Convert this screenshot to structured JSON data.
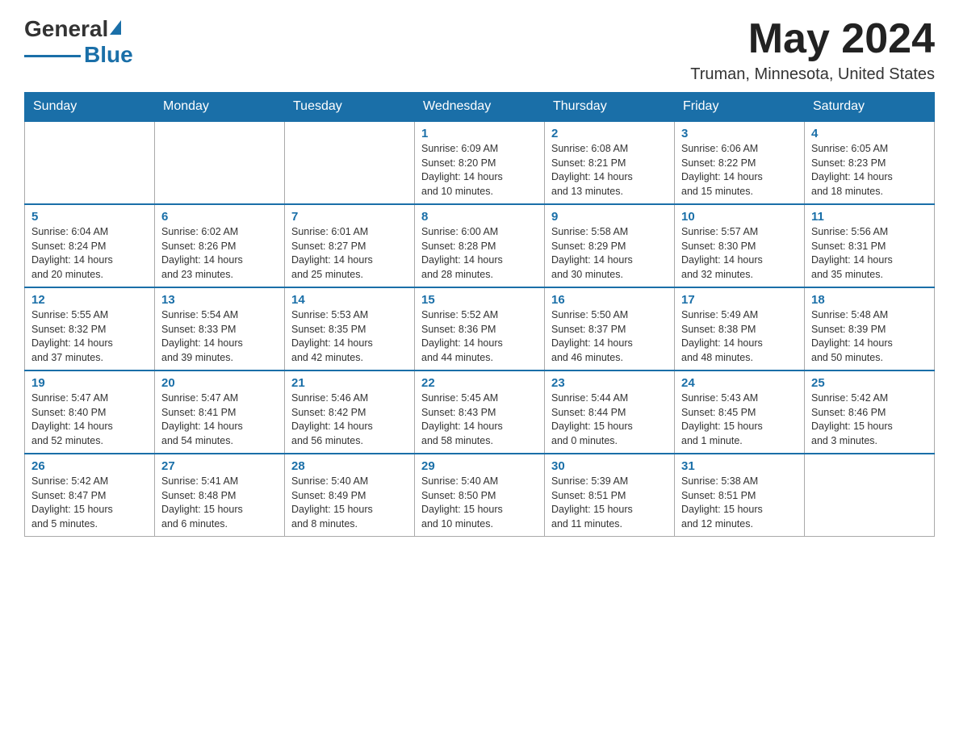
{
  "header": {
    "logo": {
      "general": "General",
      "blue": "Blue"
    },
    "month_title": "May 2024",
    "location": "Truman, Minnesota, United States"
  },
  "days_of_week": [
    "Sunday",
    "Monday",
    "Tuesday",
    "Wednesday",
    "Thursday",
    "Friday",
    "Saturday"
  ],
  "weeks": [
    [
      {
        "day": "",
        "info": ""
      },
      {
        "day": "",
        "info": ""
      },
      {
        "day": "",
        "info": ""
      },
      {
        "day": "1",
        "info": "Sunrise: 6:09 AM\nSunset: 8:20 PM\nDaylight: 14 hours\nand 10 minutes."
      },
      {
        "day": "2",
        "info": "Sunrise: 6:08 AM\nSunset: 8:21 PM\nDaylight: 14 hours\nand 13 minutes."
      },
      {
        "day": "3",
        "info": "Sunrise: 6:06 AM\nSunset: 8:22 PM\nDaylight: 14 hours\nand 15 minutes."
      },
      {
        "day": "4",
        "info": "Sunrise: 6:05 AM\nSunset: 8:23 PM\nDaylight: 14 hours\nand 18 minutes."
      }
    ],
    [
      {
        "day": "5",
        "info": "Sunrise: 6:04 AM\nSunset: 8:24 PM\nDaylight: 14 hours\nand 20 minutes."
      },
      {
        "day": "6",
        "info": "Sunrise: 6:02 AM\nSunset: 8:26 PM\nDaylight: 14 hours\nand 23 minutes."
      },
      {
        "day": "7",
        "info": "Sunrise: 6:01 AM\nSunset: 8:27 PM\nDaylight: 14 hours\nand 25 minutes."
      },
      {
        "day": "8",
        "info": "Sunrise: 6:00 AM\nSunset: 8:28 PM\nDaylight: 14 hours\nand 28 minutes."
      },
      {
        "day": "9",
        "info": "Sunrise: 5:58 AM\nSunset: 8:29 PM\nDaylight: 14 hours\nand 30 minutes."
      },
      {
        "day": "10",
        "info": "Sunrise: 5:57 AM\nSunset: 8:30 PM\nDaylight: 14 hours\nand 32 minutes."
      },
      {
        "day": "11",
        "info": "Sunrise: 5:56 AM\nSunset: 8:31 PM\nDaylight: 14 hours\nand 35 minutes."
      }
    ],
    [
      {
        "day": "12",
        "info": "Sunrise: 5:55 AM\nSunset: 8:32 PM\nDaylight: 14 hours\nand 37 minutes."
      },
      {
        "day": "13",
        "info": "Sunrise: 5:54 AM\nSunset: 8:33 PM\nDaylight: 14 hours\nand 39 minutes."
      },
      {
        "day": "14",
        "info": "Sunrise: 5:53 AM\nSunset: 8:35 PM\nDaylight: 14 hours\nand 42 minutes."
      },
      {
        "day": "15",
        "info": "Sunrise: 5:52 AM\nSunset: 8:36 PM\nDaylight: 14 hours\nand 44 minutes."
      },
      {
        "day": "16",
        "info": "Sunrise: 5:50 AM\nSunset: 8:37 PM\nDaylight: 14 hours\nand 46 minutes."
      },
      {
        "day": "17",
        "info": "Sunrise: 5:49 AM\nSunset: 8:38 PM\nDaylight: 14 hours\nand 48 minutes."
      },
      {
        "day": "18",
        "info": "Sunrise: 5:48 AM\nSunset: 8:39 PM\nDaylight: 14 hours\nand 50 minutes."
      }
    ],
    [
      {
        "day": "19",
        "info": "Sunrise: 5:47 AM\nSunset: 8:40 PM\nDaylight: 14 hours\nand 52 minutes."
      },
      {
        "day": "20",
        "info": "Sunrise: 5:47 AM\nSunset: 8:41 PM\nDaylight: 14 hours\nand 54 minutes."
      },
      {
        "day": "21",
        "info": "Sunrise: 5:46 AM\nSunset: 8:42 PM\nDaylight: 14 hours\nand 56 minutes."
      },
      {
        "day": "22",
        "info": "Sunrise: 5:45 AM\nSunset: 8:43 PM\nDaylight: 14 hours\nand 58 minutes."
      },
      {
        "day": "23",
        "info": "Sunrise: 5:44 AM\nSunset: 8:44 PM\nDaylight: 15 hours\nand 0 minutes."
      },
      {
        "day": "24",
        "info": "Sunrise: 5:43 AM\nSunset: 8:45 PM\nDaylight: 15 hours\nand 1 minute."
      },
      {
        "day": "25",
        "info": "Sunrise: 5:42 AM\nSunset: 8:46 PM\nDaylight: 15 hours\nand 3 minutes."
      }
    ],
    [
      {
        "day": "26",
        "info": "Sunrise: 5:42 AM\nSunset: 8:47 PM\nDaylight: 15 hours\nand 5 minutes."
      },
      {
        "day": "27",
        "info": "Sunrise: 5:41 AM\nSunset: 8:48 PM\nDaylight: 15 hours\nand 6 minutes."
      },
      {
        "day": "28",
        "info": "Sunrise: 5:40 AM\nSunset: 8:49 PM\nDaylight: 15 hours\nand 8 minutes."
      },
      {
        "day": "29",
        "info": "Sunrise: 5:40 AM\nSunset: 8:50 PM\nDaylight: 15 hours\nand 10 minutes."
      },
      {
        "day": "30",
        "info": "Sunrise: 5:39 AM\nSunset: 8:51 PM\nDaylight: 15 hours\nand 11 minutes."
      },
      {
        "day": "31",
        "info": "Sunrise: 5:38 AM\nSunset: 8:51 PM\nDaylight: 15 hours\nand 12 minutes."
      },
      {
        "day": "",
        "info": ""
      }
    ]
  ]
}
